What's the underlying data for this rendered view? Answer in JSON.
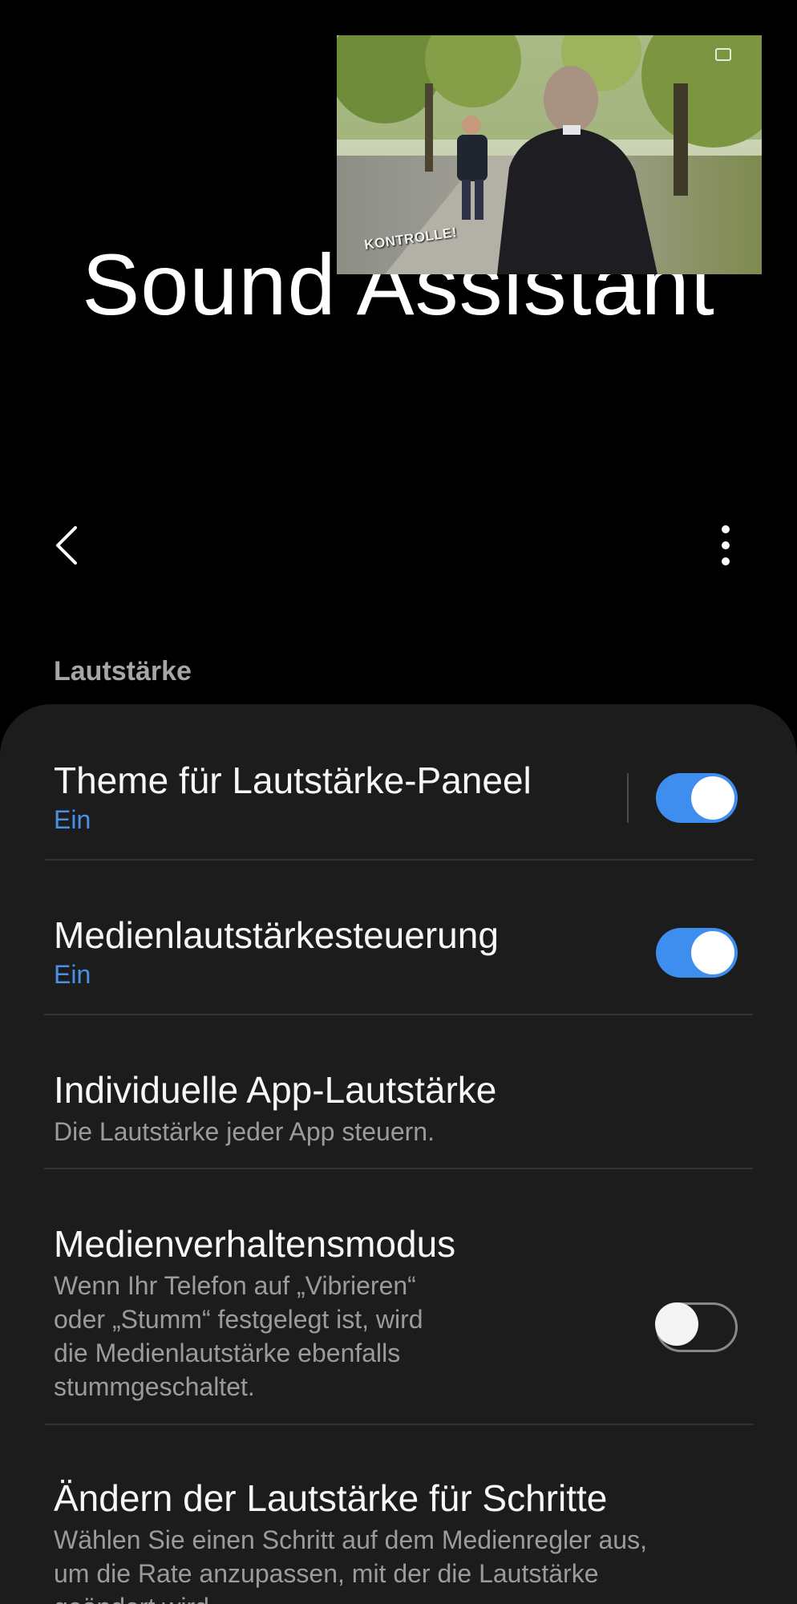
{
  "header": {
    "title": "Sound Assistant"
  },
  "pip": {
    "logo_text": "KONTROLLE!"
  },
  "toolbar": {
    "back_icon": "chevron-left-icon",
    "more_icon": "more-vertical-icon"
  },
  "section": {
    "label": "Lautstärke"
  },
  "settings": [
    {
      "title": "Theme für Lautstärke-Paneel",
      "subtitle": "Ein",
      "toggle": "on"
    },
    {
      "title": "Medienlautstärkesteuerung",
      "subtitle": "Ein",
      "toggle": "on"
    },
    {
      "title": "Individuelle App-Lautstärke",
      "description": "Die Lautstärke jeder App steuern."
    },
    {
      "title": "Medienverhaltensmodus",
      "description_lines": [
        "Wenn Ihr Telefon auf „Vibrieren“",
        "oder „Stumm“ festgelegt ist, wird",
        "die Medienlautstärke ebenfalls",
        "stummgeschaltet."
      ],
      "toggle": "off"
    },
    {
      "title": "Ändern der Lautstärke für Schritte",
      "description_lines": [
        "Wählen Sie einen Schritt auf dem Medienregler aus,",
        "um die Rate anzupassen, mit der die Lautstärke",
        "geändert wird."
      ]
    }
  ],
  "colors": {
    "accent": "#3e8ef0",
    "card": "#1c1c1c",
    "subtitle_blue": "#4a90e8"
  }
}
